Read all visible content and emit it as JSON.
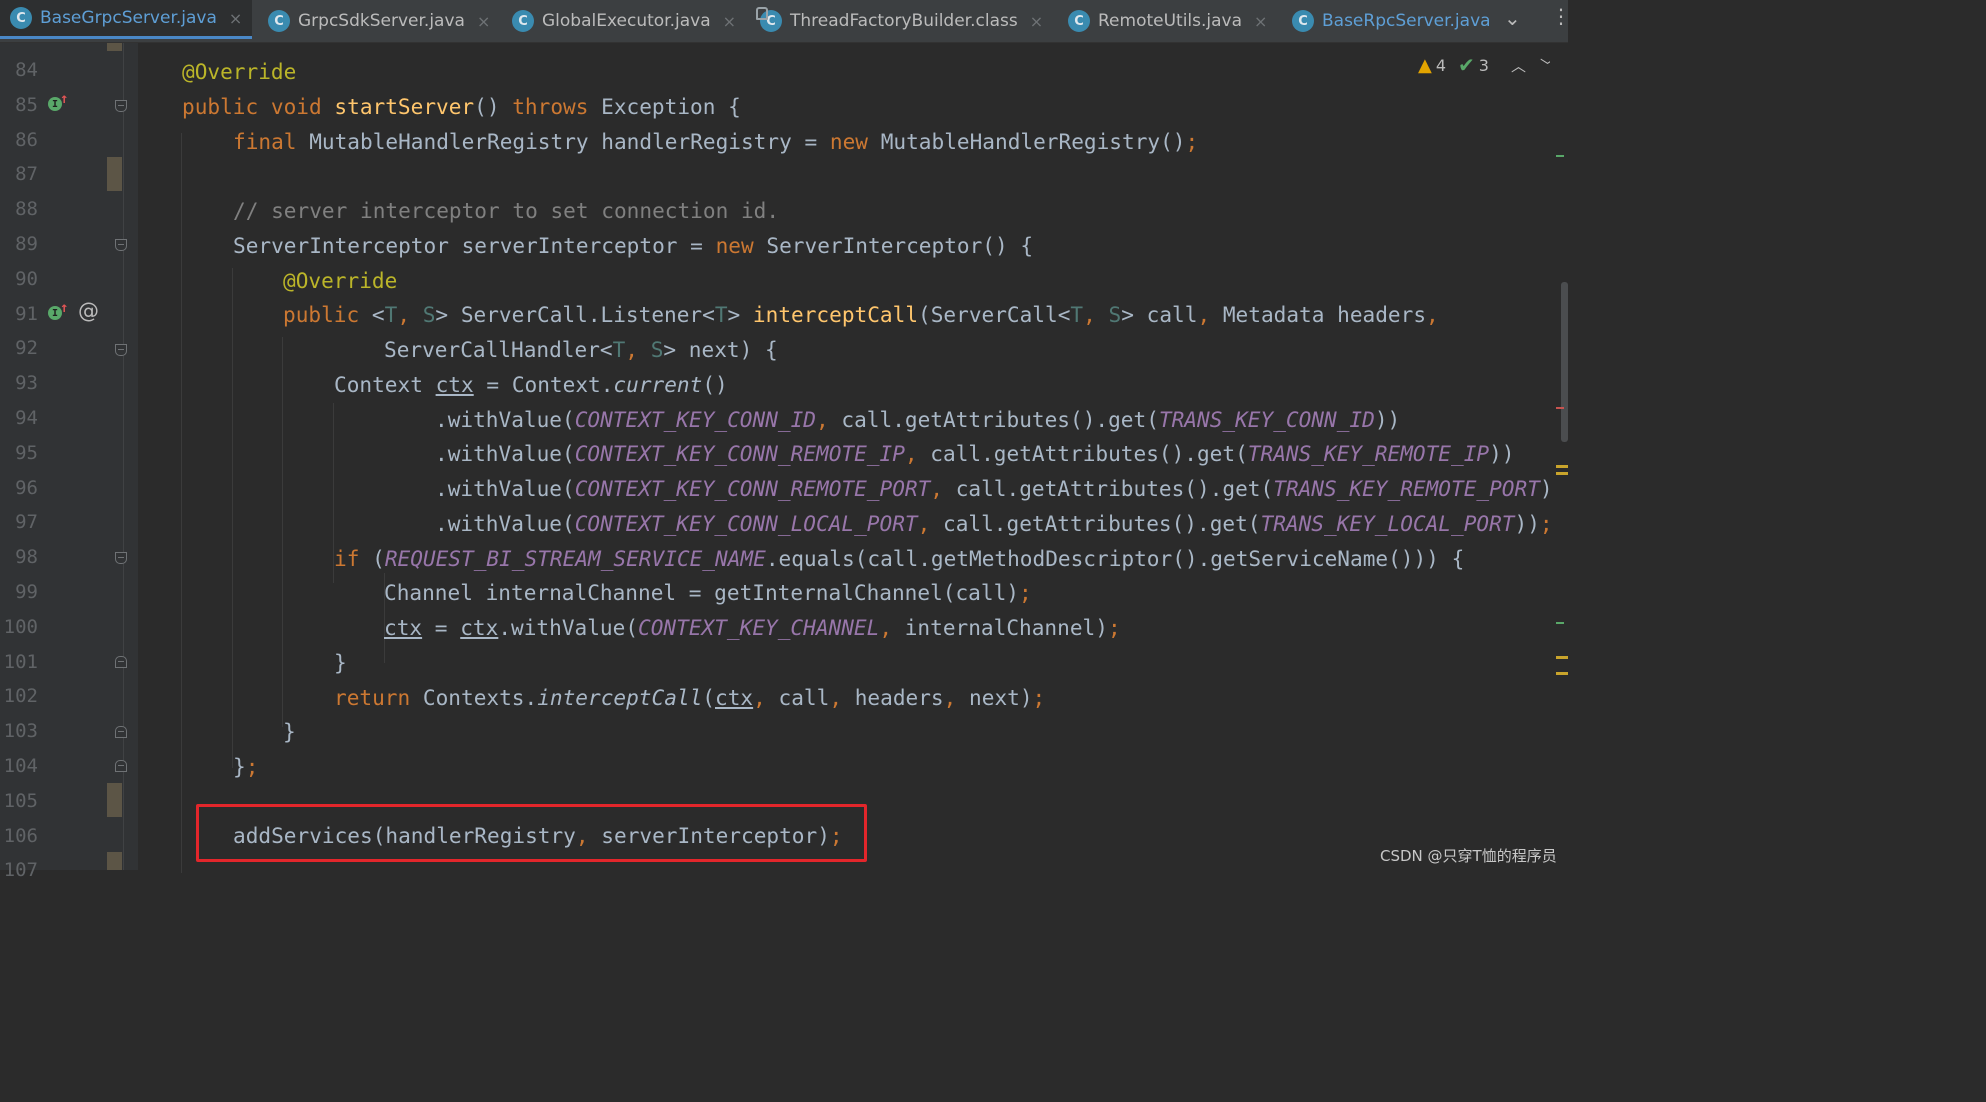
{
  "tabs": [
    {
      "label": "BaseGrpcServer.java",
      "icon": "class-icon",
      "active": true
    },
    {
      "label": "GrpcSdkServer.java",
      "icon": "class-icon",
      "active": false
    },
    {
      "label": "GlobalExecutor.java",
      "icon": "class-icon",
      "active": false
    },
    {
      "label": "ThreadFactoryBuilder.class",
      "icon": "class-locked-icon",
      "active": false
    },
    {
      "label": "RemoteUtils.java",
      "icon": "class-icon",
      "active": false
    },
    {
      "label": "BaseRpcServer.java",
      "icon": "class-icon",
      "active": false
    }
  ],
  "tab_icon_letter": "C",
  "tab_close_glyph": "×",
  "tab_overflow_glyph": "⌄",
  "more_glyph": "⋮",
  "inspections": {
    "warnings": "4",
    "ok": "3"
  },
  "line_numbers": [
    "84",
    "85",
    "86",
    "87",
    "88",
    "89",
    "90",
    "91",
    "92",
    "93",
    "94",
    "95",
    "96",
    "97",
    "98",
    "99",
    "100",
    "101",
    "102",
    "103",
    "104",
    "105",
    "106",
    "107"
  ],
  "code": {
    "l84": "@Override",
    "l85": [
      "public",
      "void",
      "startServer",
      "() ",
      "throws",
      " Exception {"
    ],
    "l86": [
      "final",
      " MutableHandlerRegistry handlerRegistry = ",
      "new",
      " MutableHandlerRegistry()",
      ";"
    ],
    "l88": "// server interceptor to set connection id.",
    "l89": [
      "ServerInterceptor serverInterceptor = ",
      "new",
      " ServerInterceptor() {"
    ],
    "l90": "@Override",
    "l91": [
      "public",
      " <",
      "T",
      ", ",
      "S",
      "> ServerCall.Listener<",
      "T",
      "> ",
      "interceptCall",
      "(ServerCall<",
      "T",
      ", ",
      "S",
      "> call",
      ", ",
      "Metadata headers",
      ","
    ],
    "l92": [
      "ServerCallHandler<",
      "T",
      ", ",
      "S",
      "> next) {"
    ],
    "l93": [
      "Context ",
      "ctx",
      " = Context.",
      "current",
      "()"
    ],
    "l94": [
      ".withValue(",
      "CONTEXT_KEY_CONN_ID",
      ", ",
      "call.getAttributes().get(",
      "TRANS_KEY_CONN_ID",
      "))"
    ],
    "l95": [
      ".withValue(",
      "CONTEXT_KEY_CONN_REMOTE_IP",
      ", ",
      "call.getAttributes().get(",
      "TRANS_KEY_REMOTE_IP",
      "))"
    ],
    "l96": [
      ".withValue(",
      "CONTEXT_KEY_CONN_REMOTE_PORT",
      ", ",
      "call.getAttributes().get(",
      "TRANS_KEY_REMOTE_PORT",
      "))"
    ],
    "l97": [
      ".withValue(",
      "CONTEXT_KEY_CONN_LOCAL_PORT",
      ", ",
      "call.getAttributes().get(",
      "TRANS_KEY_LOCAL_PORT",
      "))",
      ";"
    ],
    "l98": [
      "if",
      " (",
      "REQUEST_BI_STREAM_SERVICE_NAME",
      ".equals(call.getMethodDescriptor().getServiceName())) {"
    ],
    "l99": [
      "Channel internalChannel = getInternalChannel(call)",
      ";"
    ],
    "l100": [
      "ctx",
      " = ",
      "ctx",
      ".withValue(",
      "CONTEXT_KEY_CHANNEL",
      ", ",
      "internalChannel)",
      ";"
    ],
    "l101": "}",
    "l102": [
      "return",
      " Contexts.",
      "interceptCall",
      "(",
      "ctx",
      ", ",
      "call",
      ", ",
      "headers",
      ", ",
      "next)",
      ";"
    ],
    "l103": "}",
    "l104": [
      "}",
      ";"
    ],
    "l106": [
      "addServices(handlerRegistry",
      ", ",
      "serverInterceptor)",
      ";"
    ]
  },
  "colors": {
    "keyword": "#cc7832",
    "annotation": "#bbb529",
    "method_decl": "#ffc66d",
    "comment": "#808080",
    "constant": "#9876aa",
    "type_param": "#507874",
    "default_text": "#a9b7c6",
    "highlight_box": "#e3262b"
  },
  "watermark": "CSDN @只穿T恤的程序员"
}
